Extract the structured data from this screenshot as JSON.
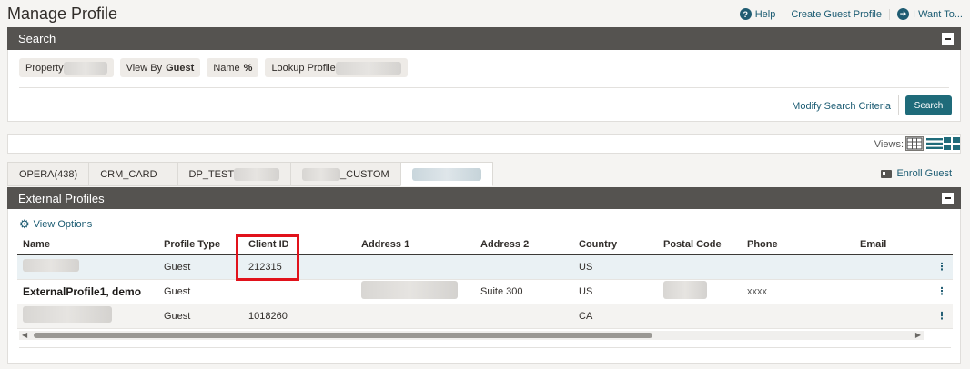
{
  "page": {
    "title": "Manage Profile"
  },
  "top_actions": [
    {
      "label": "Help",
      "icon": "question-circle-icon"
    },
    {
      "label": "Create Guest Profile"
    },
    {
      "label": "I Want To...",
      "icon": "arrow-circle-right-icon"
    }
  ],
  "search": {
    "title": "Search",
    "chips": {
      "property_label": "Property",
      "view_by_label": "View By",
      "view_by_value": "Guest",
      "name_label": "Name",
      "name_value": "%",
      "lookup_label": "Lookup Profile"
    },
    "modify_link": "Modify Search Criteria",
    "search_button": "Search"
  },
  "views": {
    "label": "Views:"
  },
  "tabs": [
    {
      "label": "OPERA(438)"
    },
    {
      "label": "CRM_CARD"
    },
    {
      "label": "DP_TEST"
    },
    {
      "label": "_CUSTOM"
    },
    {
      "label": ""
    }
  ],
  "enroll_guest": "Enroll Guest",
  "external_profiles": {
    "title": "External Profiles",
    "view_options": "View Options",
    "columns": [
      "Name",
      "Profile Type",
      "Client ID",
      "Address 1",
      "Address 2",
      "Country",
      "Postal Code",
      "Phone",
      "Email"
    ],
    "rows": [
      {
        "name": "",
        "profile_type": "Guest",
        "client_id": "212315",
        "address1": "",
        "address2": "",
        "country": "US",
        "postal": "",
        "phone": "",
        "email": ""
      },
      {
        "name": "ExternalProfile1, demo",
        "profile_type": "Guest",
        "client_id": "",
        "address1": "",
        "address2": "Suite 300",
        "country": "US",
        "postal": "",
        "phone": "xxxx",
        "email": ""
      },
      {
        "name": "",
        "profile_type": "Guest",
        "client_id": "1018260",
        "address1": "",
        "address2": "",
        "country": "CA",
        "postal": "",
        "phone": "",
        "email": ""
      }
    ]
  },
  "colors": {
    "header_bg": "#555350",
    "accent": "#1f6b7a",
    "link": "#1c5c73",
    "highlight": "#e1121b"
  }
}
